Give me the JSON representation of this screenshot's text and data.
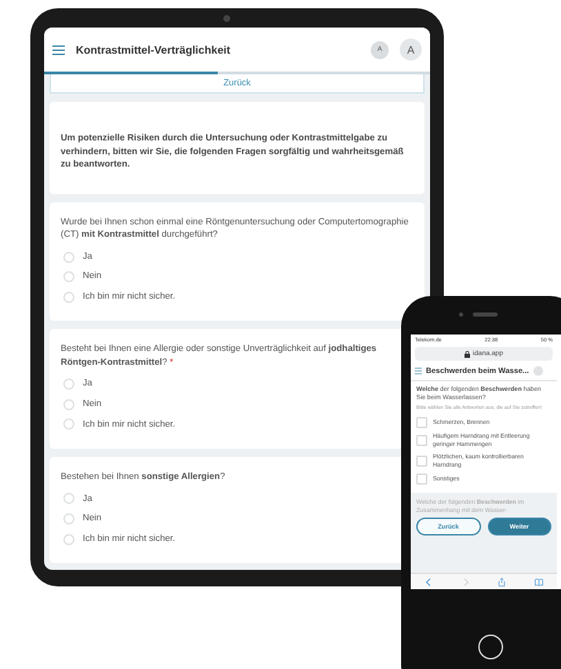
{
  "tablet": {
    "header": {
      "title": "Kontrastmittel-Verträglichkeit",
      "avatars": [
        "A",
        "A"
      ]
    },
    "progress": {
      "level": 0.45
    },
    "back_link": "Zurück",
    "intro": "Um potenzielle Risiken durch die Untersuchung oder Kontrastmittelgabe zu verhindern, bitten wir Sie, die folgenden Fragen sorgfältig und wahrheitsgemäß zu beantworten.",
    "questions": [
      {
        "text": "Wurde bei Ihnen schon einmal eine Röntgenuntersuchung oder Computertomographie (CT) **mit Kontrastmittel** durchgeführt?",
        "options": [
          {
            "label": "Ja",
            "selected": false
          },
          {
            "label": "Nein",
            "selected": false
          },
          {
            "label": "Ich bin mir nicht sicher.",
            "selected": false
          }
        ]
      },
      {
        "text": "Besteht bei Ihnen eine Allergie oder sonstige Unverträglichkeit auf **jodhaltiges Röntgen-Kontrastmittel**?",
        "required_mark": "*",
        "options": [
          {
            "label": "Ja",
            "selected": false
          },
          {
            "label": "Nein",
            "selected": false
          },
          {
            "label": "Ich bin mir nicht sicher.",
            "selected": false
          }
        ]
      },
      {
        "text": "Bestehen bei Ihnen **sonstige Allergien**?",
        "options": [
          {
            "label": "Ja",
            "selected": false
          },
          {
            "label": "Nein",
            "selected": false
          },
          {
            "label": "Ich bin mir nicht sicher.",
            "selected": false
          }
        ]
      }
    ]
  },
  "phone": {
    "status_bar": {
      "carrier": "Telekom.de",
      "time": "22:38",
      "battery": "50 %"
    },
    "url": "idana.app",
    "header": {
      "title": "Beschwerden beim Wasse..."
    },
    "question": {
      "text": "**Welche** der folgenden **Beschwerden** haben Sie beim Wasserlassen?",
      "hint": "Bitte wählen Sie alle Antworten aus, die auf Sie zutreffen!",
      "options": [
        {
          "label": "Schmerzen, Brennen",
          "checked": false
        },
        {
          "label": "Häufigem Harndrang mit Entleerung geringer Harnmengen",
          "checked": false
        },
        {
          "label": "Plötzlichen, kaum kontrollierbaren Harndrang",
          "checked": false
        },
        {
          "label": "Sonstiges",
          "checked": false
        }
      ]
    },
    "next_question": "Welche der folgenden **Beschwerden** im Zusammenhang mit dem Wasser-",
    "buttons": [
      {
        "label": "Zurück",
        "kind": "secondary"
      },
      {
        "label": "Weiter",
        "kind": "primary"
      }
    ]
  }
}
